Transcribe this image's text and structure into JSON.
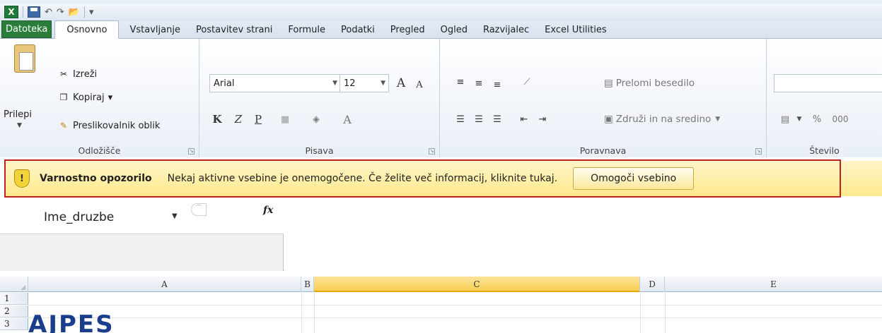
{
  "qat": {
    "logo_glyph": "X",
    "undo": "↶",
    "redo": "↷",
    "folder": "📂",
    "customize": "▾"
  },
  "tabs": [
    {
      "label": "Datoteka"
    },
    {
      "label": "Osnovno"
    },
    {
      "label": "Vstavljanje"
    },
    {
      "label": "Postavitev strani"
    },
    {
      "label": "Formule"
    },
    {
      "label": "Podatki"
    },
    {
      "label": "Pregled"
    },
    {
      "label": "Ogled"
    },
    {
      "label": "Razvijalec"
    },
    {
      "label": "Excel Utilities"
    }
  ],
  "clipboard": {
    "paste": "Prilepi",
    "cut": "Izreži",
    "copy": "Kopiraj",
    "copy_arrow": "▾",
    "format_painter": "Preslikovalnik oblik",
    "group": "Odložišče"
  },
  "font": {
    "name": "Arial",
    "size": "12",
    "bold": "K",
    "italic": "Z",
    "underline": "P",
    "group": "Pisava"
  },
  "alignment": {
    "wrap": "Prelomi besedilo",
    "merge": "Združi in na sredino",
    "group": "Poravnava"
  },
  "number": {
    "percent": "%",
    "thousands": "000",
    "group": "Število"
  },
  "alert": {
    "title": "Varnostno opozorilo",
    "message": "Nekaj aktivne vsebine je onemogočene. Če želite več informacij, kliknite tukaj.",
    "button": "Omogoči vsebino",
    "icon_glyph": "!"
  },
  "formula_bar": {
    "name_box": "Ime_druzbe",
    "fx": "fx"
  },
  "columns": [
    {
      "label": "A"
    },
    {
      "label": "B"
    },
    {
      "label": "C"
    },
    {
      "label": "D"
    },
    {
      "label": "E"
    }
  ],
  "rows": [
    "1",
    "2",
    "3"
  ],
  "logo_text": "AJPES"
}
